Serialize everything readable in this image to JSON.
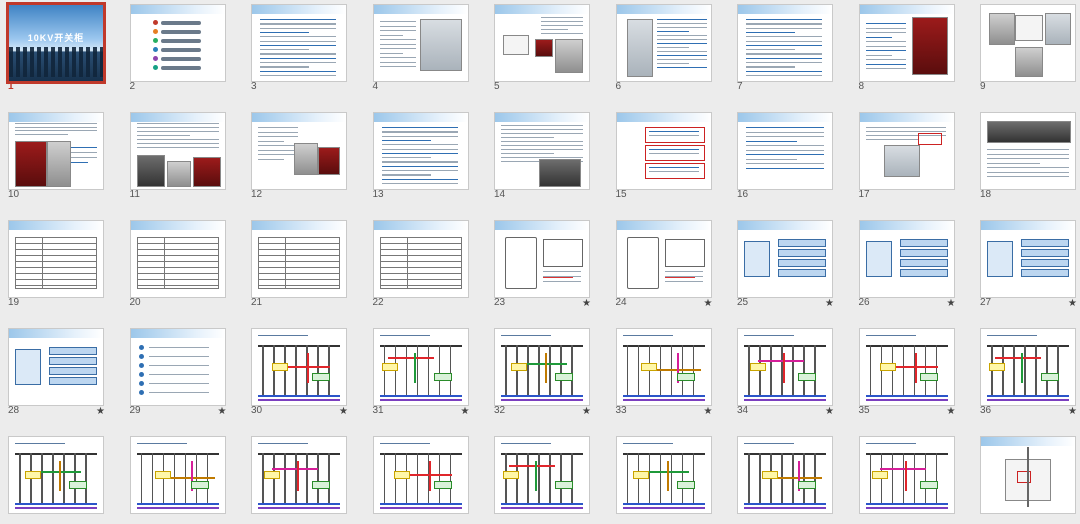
{
  "sorter": {
    "cover_title": "10KV开关柜",
    "selected_slide": 1,
    "slides": [
      {
        "n": "1",
        "anim": false,
        "t": "cover"
      },
      {
        "n": "2",
        "anim": false,
        "t": "toc"
      },
      {
        "n": "3",
        "anim": false,
        "t": "text"
      },
      {
        "n": "4",
        "anim": false,
        "t": "textpic"
      },
      {
        "n": "5",
        "anim": false,
        "t": "parts"
      },
      {
        "n": "6",
        "anim": false,
        "t": "cabinet"
      },
      {
        "n": "7",
        "anim": false,
        "t": "text"
      },
      {
        "n": "8",
        "anim": false,
        "t": "breaker"
      },
      {
        "n": "9",
        "anim": false,
        "t": "photos"
      },
      {
        "n": "10",
        "anim": false,
        "t": "breakerwide"
      },
      {
        "n": "11",
        "anim": false,
        "t": "textpics"
      },
      {
        "n": "12",
        "anim": false,
        "t": "textpic2"
      },
      {
        "n": "13",
        "anim": false,
        "t": "text"
      },
      {
        "n": "14",
        "anim": false,
        "t": "textpicr"
      },
      {
        "n": "15",
        "anim": false,
        "t": "flow"
      },
      {
        "n": "16",
        "anim": false,
        "t": "textblue"
      },
      {
        "n": "17",
        "anim": false,
        "t": "textpic3"
      },
      {
        "n": "18",
        "anim": false,
        "t": "photosrow"
      },
      {
        "n": "19",
        "anim": false,
        "t": "table"
      },
      {
        "n": "20",
        "anim": false,
        "t": "table"
      },
      {
        "n": "21",
        "anim": false,
        "t": "table"
      },
      {
        "n": "22",
        "anim": false,
        "t": "table"
      },
      {
        "n": "23",
        "anim": true,
        "t": "circuit"
      },
      {
        "n": "24",
        "anim": true,
        "t": "circuit"
      },
      {
        "n": "25",
        "anim": true,
        "t": "diagram"
      },
      {
        "n": "26",
        "anim": true,
        "t": "diagram"
      },
      {
        "n": "27",
        "anim": true,
        "t": "diagram"
      },
      {
        "n": "28",
        "anim": true,
        "t": "diagram"
      },
      {
        "n": "29",
        "anim": true,
        "t": "dots"
      },
      {
        "n": "30",
        "anim": true,
        "t": "wiring"
      },
      {
        "n": "31",
        "anim": true,
        "t": "wiring"
      },
      {
        "n": "32",
        "anim": true,
        "t": "wiring"
      },
      {
        "n": "33",
        "anim": true,
        "t": "wiring"
      },
      {
        "n": "34",
        "anim": true,
        "t": "wiring"
      },
      {
        "n": "35",
        "anim": true,
        "t": "wiring"
      },
      {
        "n": "36",
        "anim": true,
        "t": "wiring"
      },
      {
        "n": "",
        "anim": false,
        "t": "wiring"
      },
      {
        "n": "",
        "anim": false,
        "t": "wiring"
      },
      {
        "n": "",
        "anim": false,
        "t": "wiring"
      },
      {
        "n": "",
        "anim": false,
        "t": "wiring"
      },
      {
        "n": "",
        "anim": false,
        "t": "wiring"
      },
      {
        "n": "",
        "anim": false,
        "t": "wiring"
      },
      {
        "n": "",
        "anim": false,
        "t": "wiring"
      },
      {
        "n": "",
        "anim": false,
        "t": "wiring"
      },
      {
        "n": "",
        "anim": false,
        "t": "cabinet2"
      }
    ],
    "star_symbol": "★"
  }
}
